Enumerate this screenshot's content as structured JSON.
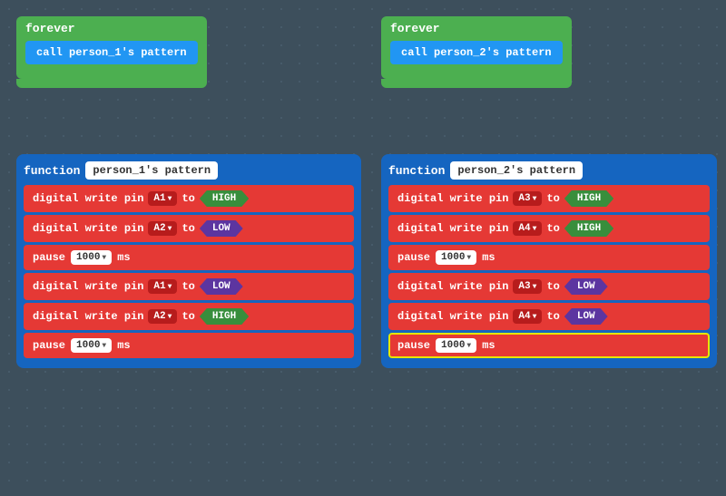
{
  "colors": {
    "background": "#3d4f5c",
    "forever": "#4caf50",
    "call": "#2196f3",
    "function_bg": "#1565c0",
    "dw_bg": "#e53935",
    "pin_bg": "#b71c1c",
    "high": "#388e3c",
    "low": "#5c35a0",
    "pause_bg": "#e53935",
    "white": "#ffffff"
  },
  "forever1": {
    "label": "forever",
    "call": "call person_1's pattern"
  },
  "forever2": {
    "label": "forever",
    "call": "call person_2's pattern"
  },
  "function1": {
    "label": "function",
    "name": "person_1's pattern",
    "rows": [
      {
        "type": "dw",
        "text": "digital write pin",
        "pin": "A1",
        "to": "to",
        "value": "HIGH",
        "valueType": "high"
      },
      {
        "type": "dw",
        "text": "digital write pin",
        "pin": "A2",
        "to": "to",
        "value": "LOW",
        "valueType": "low"
      },
      {
        "type": "pause",
        "value": "1000",
        "ms": "ms"
      },
      {
        "type": "dw",
        "text": "digital write pin",
        "pin": "A1",
        "to": "to",
        "value": "LOW",
        "valueType": "low"
      },
      {
        "type": "dw",
        "text": "digital write pin",
        "pin": "A2",
        "to": "to",
        "value": "HIGH",
        "valueType": "high"
      },
      {
        "type": "pause",
        "value": "1000",
        "ms": "ms"
      }
    ]
  },
  "function2": {
    "label": "function",
    "name": "person_2's pattern",
    "rows": [
      {
        "type": "dw",
        "text": "digital write pin",
        "pin": "A3",
        "to": "to",
        "value": "HIGH",
        "valueType": "high"
      },
      {
        "type": "dw",
        "text": "digital write pin",
        "pin": "A4",
        "to": "to",
        "value": "HIGH",
        "valueType": "high"
      },
      {
        "type": "pause",
        "value": "1000",
        "ms": "ms"
      },
      {
        "type": "dw",
        "text": "digital write pin",
        "pin": "A3",
        "to": "to",
        "value": "LOW",
        "valueType": "low"
      },
      {
        "type": "dw",
        "text": "digital write pin",
        "pin": "A4",
        "to": "to",
        "value": "LOW",
        "valueType": "low"
      },
      {
        "type": "pause",
        "value": "1000",
        "ms": "ms",
        "highlighted": true
      }
    ]
  }
}
